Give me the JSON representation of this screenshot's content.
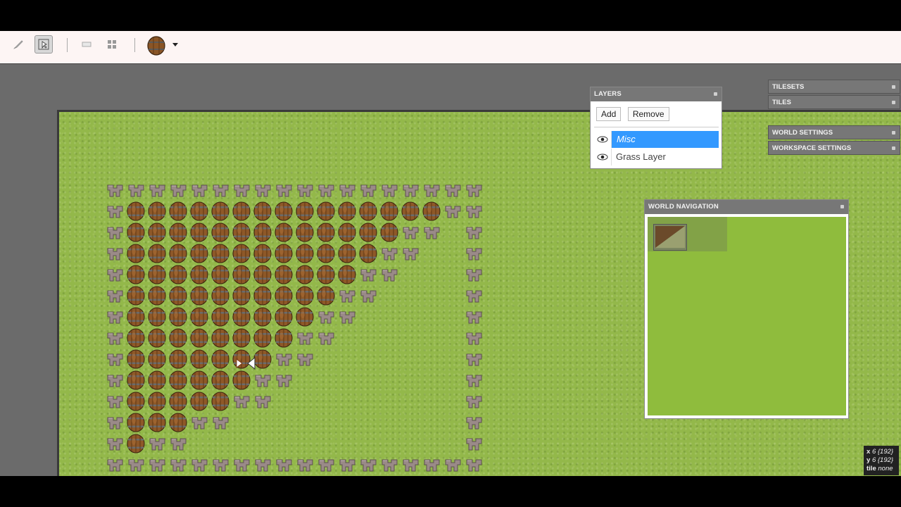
{
  "toolbar": {
    "tools": [
      {
        "name": "brush-tool",
        "active": false
      },
      {
        "name": "select-tool",
        "active": true
      },
      {
        "name": "single-tile-mode",
        "active": false
      },
      {
        "name": "multi-tile-mode",
        "active": false
      }
    ],
    "current_tile": "barrel"
  },
  "layers_panel": {
    "title": "LAYERS",
    "add_label": "Add",
    "remove_label": "Remove",
    "layers": [
      {
        "name": "Misc",
        "selected": true
      },
      {
        "name": "Grass Layer",
        "selected": false
      }
    ]
  },
  "side_panels": {
    "tilesets": "TILESETS",
    "tiles": "TILES",
    "world_settings": "WORLD SETTINGS",
    "workspace_settings": "WORKSPACE SETTINGS"
  },
  "navigation": {
    "title": "WORLD NAVIGATION"
  },
  "status": {
    "x_label": "x",
    "x_value": "6 {192}",
    "y_label": "y",
    "y_value": "6 {192}",
    "tile_label": "tile",
    "tile_value": "none"
  },
  "colors": {
    "selection": "#3399ff",
    "grass": "#93b84a",
    "panel_header": "#777777"
  }
}
